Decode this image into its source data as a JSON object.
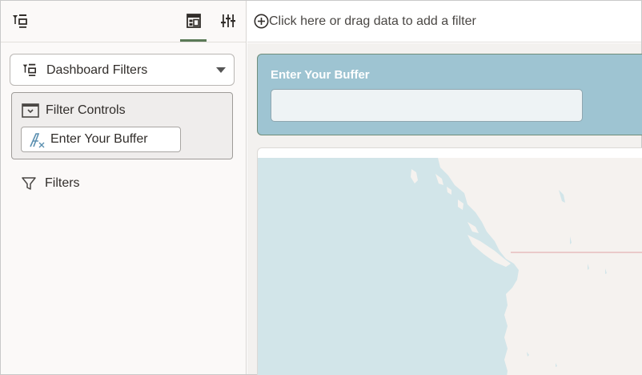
{
  "left_panel": {
    "toolbar": {
      "icons": [
        "filter-list-icon",
        "layout-panel-icon",
        "sliders-icon"
      ],
      "active_tab": "layout-panel"
    },
    "dropdown": {
      "label": "Dashboard Filters",
      "icon": "filter-list-icon"
    },
    "filter_controls": {
      "label": "Filter Controls",
      "items": [
        {
          "label": "Enter Your Buffer",
          "icon": "fx-icon"
        }
      ]
    },
    "filters": {
      "label": "Filters",
      "icon": "funnel-icon"
    }
  },
  "filter_bar": {
    "placeholder": "Click here or drag data to add a filter",
    "icon": "add-circle-icon"
  },
  "canvas": {
    "buffer_card": {
      "title": "Enter Your Buffer",
      "input_value": ""
    },
    "map": {
      "water_color": "#d2e5e9",
      "land_color": "#f5f2ef",
      "border_color": "#e3b2b5"
    }
  },
  "colors": {
    "accent": "#5b7a57",
    "card_blue": "#9ec4d2"
  }
}
